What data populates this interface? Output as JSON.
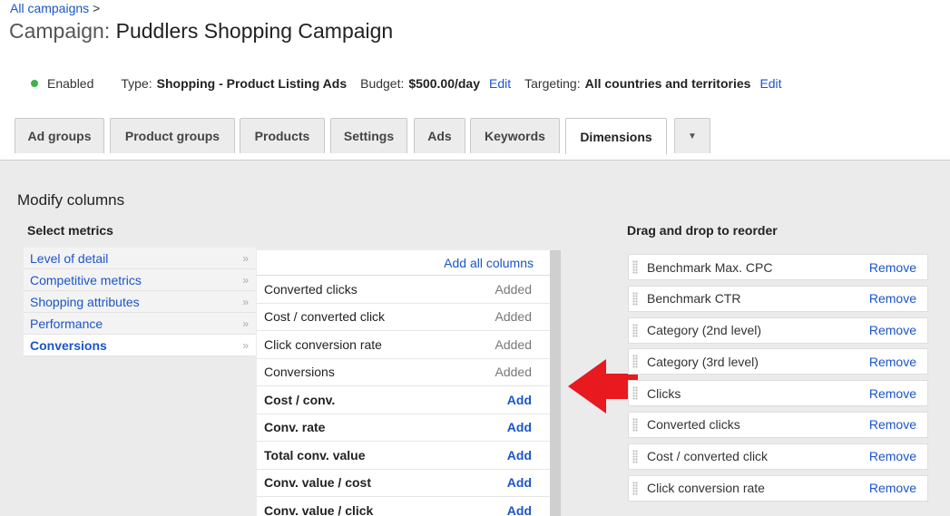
{
  "breadcrumb": {
    "link": "All campaigns",
    "separator": ">"
  },
  "header": {
    "prefix": "Campaign:",
    "name": "Puddlers Shopping Campaign"
  },
  "status": {
    "state": "Enabled",
    "type_label": "Type:",
    "type_value": "Shopping - Product Listing Ads",
    "budget_label": "Budget:",
    "budget_value": "$500.00/day",
    "budget_edit": "Edit",
    "targeting_label": "Targeting:",
    "targeting_value": "All countries and territories",
    "targeting_edit": "Edit",
    "state_color": "#3bb34a"
  },
  "tabs": [
    {
      "label": "Ad groups"
    },
    {
      "label": "Product groups"
    },
    {
      "label": "Products"
    },
    {
      "label": "Settings"
    },
    {
      "label": "Ads"
    },
    {
      "label": "Keywords"
    },
    {
      "label": "Dimensions",
      "active": true
    }
  ],
  "tabs_more_icon": "chevron-down-icon",
  "modify": {
    "title": "Modify columns",
    "select_metrics_label": "Select metrics",
    "categories": [
      {
        "label": "Level of detail",
        "arrow": "»"
      },
      {
        "label": "Competitive metrics",
        "arrow": "»"
      },
      {
        "label": "Shopping attributes",
        "arrow": "»"
      },
      {
        "label": "Performance",
        "arrow": "»"
      },
      {
        "label": "Conversions",
        "arrow": "»",
        "selected": true
      }
    ],
    "add_all_label": "Add all columns",
    "metrics": [
      {
        "name": "Converted clicks",
        "status": "Added"
      },
      {
        "name": "Cost / converted click",
        "status": "Added"
      },
      {
        "name": "Click conversion rate",
        "status": "Added"
      },
      {
        "name": "Conversions",
        "status": "Added"
      },
      {
        "name": "Cost / conv.",
        "status": "Add"
      },
      {
        "name": "Conv. rate",
        "status": "Add"
      },
      {
        "name": "Total conv. value",
        "status": "Add"
      },
      {
        "name": "Conv. value / cost",
        "status": "Add"
      },
      {
        "name": "Conv. value / click",
        "status": "Add"
      }
    ],
    "reorder_label": "Drag and drop to reorder",
    "columns": [
      {
        "name": "Benchmark Max. CPC",
        "action": "Remove"
      },
      {
        "name": "Benchmark CTR",
        "action": "Remove"
      },
      {
        "name": "Category (2nd level)",
        "action": "Remove"
      },
      {
        "name": "Category (3rd level)",
        "action": "Remove"
      },
      {
        "name": "Clicks",
        "action": "Remove"
      },
      {
        "name": "Converted clicks",
        "action": "Remove"
      },
      {
        "name": "Cost / converted click",
        "action": "Remove"
      },
      {
        "name": "Click conversion rate",
        "action": "Remove"
      }
    ]
  },
  "annotation": {
    "arrow_color": "#e8191f",
    "arrow_icon": "red-left-arrow-icon"
  }
}
